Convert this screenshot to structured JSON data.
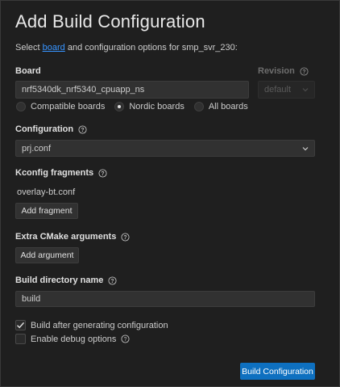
{
  "title": "Add Build Configuration",
  "subtitle": {
    "prefix": "Select ",
    "link": "board",
    "suffix": " and configuration options for smp_svr_230:"
  },
  "board": {
    "label": "Board",
    "value": "nrf5340dk_nrf5340_cpuapp_ns",
    "filters": [
      {
        "label": "Compatible boards",
        "selected": false
      },
      {
        "label": "Nordic boards",
        "selected": true
      },
      {
        "label": "All boards",
        "selected": false
      }
    ]
  },
  "revision": {
    "label": "Revision",
    "placeholder": "default"
  },
  "configuration": {
    "label": "Configuration",
    "value": "prj.conf"
  },
  "kconfig": {
    "label": "Kconfig fragments",
    "items": [
      "overlay-bt.conf"
    ],
    "add_label": "Add fragment"
  },
  "cmake": {
    "label": "Extra CMake arguments",
    "add_label": "Add argument"
  },
  "build_dir": {
    "label": "Build directory name",
    "value": "build"
  },
  "options": {
    "build_after": {
      "label": "Build after generating configuration",
      "checked": true
    },
    "debug": {
      "label": "Enable debug options",
      "checked": false
    }
  },
  "submit_label": "Build Configuration",
  "colors": {
    "background": "#1f1f1f",
    "link": "#3794ff",
    "primary_button": "#0e70c0"
  }
}
